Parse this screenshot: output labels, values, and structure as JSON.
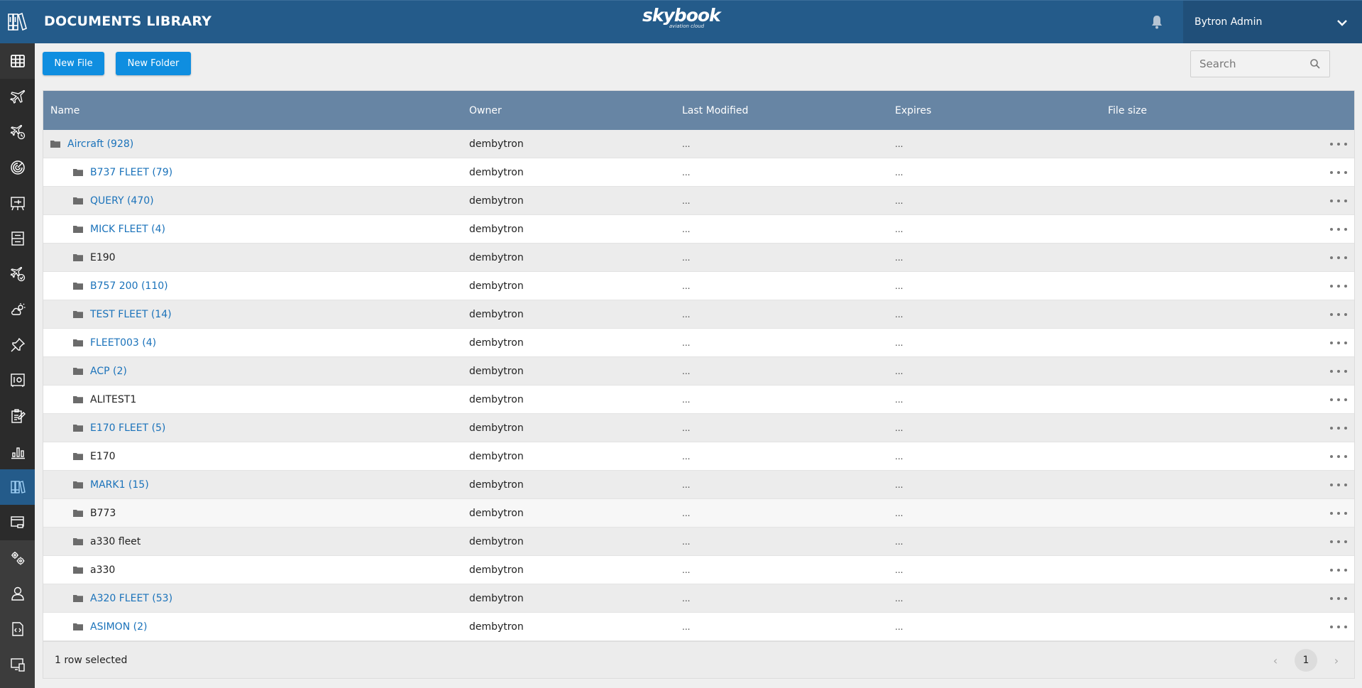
{
  "header": {
    "title": "DOCUMENTS LIBRARY",
    "brand_name": "skybook",
    "brand_tagline": "aviation cloud",
    "user_name": "Bytron Admin"
  },
  "colors": {
    "header_bg": "#245b8a",
    "accent_button": "#0f8ee0",
    "table_header_bg": "#6785a4",
    "link": "#1a72ba",
    "sidebar_bg": "#3c3c3c"
  },
  "sidebar": {
    "items": [
      {
        "icon": "grid-icon",
        "label": "Dashboard"
      },
      {
        "icon": "airplane-icon",
        "label": "Flights"
      },
      {
        "icon": "airplane-clock-icon",
        "label": "Flight schedule"
      },
      {
        "icon": "radar-icon",
        "label": "Tracking"
      },
      {
        "icon": "briefing-board-icon",
        "label": "Briefing"
      },
      {
        "icon": "cabinet-icon",
        "label": "Storage"
      },
      {
        "icon": "airplane-time-icon",
        "label": "Duty times"
      },
      {
        "icon": "weather-icon",
        "label": "Weather"
      },
      {
        "icon": "pin-icon",
        "label": "Pins"
      },
      {
        "icon": "safe-icon",
        "label": "Vault"
      },
      {
        "icon": "clipboard-edit-icon",
        "label": "Reports"
      },
      {
        "icon": "bar-chart-icon",
        "label": "Analytics"
      },
      {
        "icon": "library-icon",
        "label": "Documents Library",
        "active": true
      },
      {
        "icon": "window-icon",
        "label": "Display"
      },
      {
        "icon": "gears-icon",
        "label": "Settings"
      },
      {
        "icon": "user-icon",
        "label": "Users"
      },
      {
        "icon": "code-file-icon",
        "label": "API"
      },
      {
        "icon": "devices-icon",
        "label": "Devices"
      }
    ]
  },
  "toolbar": {
    "new_file_label": "New File",
    "new_folder_label": "New Folder",
    "search_placeholder": "Search"
  },
  "table": {
    "columns": [
      "Name",
      "Owner",
      "Last Modified",
      "Expires",
      "File size"
    ],
    "rows": [
      {
        "name": "Aircraft (928)",
        "link": true,
        "level": 0,
        "owner": "dembytron",
        "modified": "...",
        "expires": "...",
        "size": ""
      },
      {
        "name": "B737 FLEET (79)",
        "link": true,
        "level": 1,
        "owner": "dembytron",
        "modified": "...",
        "expires": "...",
        "size": ""
      },
      {
        "name": "QUERY (470)",
        "link": true,
        "level": 1,
        "owner": "dembytron",
        "modified": "...",
        "expires": "...",
        "size": ""
      },
      {
        "name": "MICK FLEET (4)",
        "link": true,
        "level": 1,
        "owner": "dembytron",
        "modified": "...",
        "expires": "...",
        "size": ""
      },
      {
        "name": "E190",
        "link": false,
        "level": 1,
        "owner": "dembytron",
        "modified": "...",
        "expires": "...",
        "size": ""
      },
      {
        "name": "B757 200 (110)",
        "link": true,
        "level": 1,
        "owner": "dembytron",
        "modified": "...",
        "expires": "...",
        "size": ""
      },
      {
        "name": "TEST FLEET (14)",
        "link": true,
        "level": 1,
        "owner": "dembytron",
        "modified": "...",
        "expires": "...",
        "size": ""
      },
      {
        "name": "FLEET003 (4)",
        "link": true,
        "level": 1,
        "owner": "dembytron",
        "modified": "...",
        "expires": "...",
        "size": ""
      },
      {
        "name": "ACP (2)",
        "link": true,
        "level": 1,
        "owner": "dembytron",
        "modified": "...",
        "expires": "...",
        "size": ""
      },
      {
        "name": "ALITEST1",
        "link": false,
        "level": 1,
        "owner": "dembytron",
        "modified": "...",
        "expires": "...",
        "size": ""
      },
      {
        "name": "E170 FLEET (5)",
        "link": true,
        "level": 1,
        "owner": "dembytron",
        "modified": "...",
        "expires": "...",
        "size": ""
      },
      {
        "name": "E170",
        "link": false,
        "level": 1,
        "owner": "dembytron",
        "modified": "...",
        "expires": "...",
        "size": ""
      },
      {
        "name": "MARK1 (15)",
        "link": true,
        "level": 1,
        "owner": "dembytron",
        "modified": "...",
        "expires": "...",
        "size": ""
      },
      {
        "name": "B773",
        "link": false,
        "level": 1,
        "owner": "dembytron",
        "modified": "...",
        "expires": "...",
        "size": "",
        "hover": true
      },
      {
        "name": "a330 fleet",
        "link": false,
        "level": 1,
        "owner": "dembytron",
        "modified": "...",
        "expires": "...",
        "size": ""
      },
      {
        "name": "a330",
        "link": false,
        "level": 1,
        "owner": "dembytron",
        "modified": "...",
        "expires": "...",
        "size": ""
      },
      {
        "name": "A320 FLEET (53)",
        "link": true,
        "level": 1,
        "owner": "dembytron",
        "modified": "...",
        "expires": "...",
        "size": ""
      },
      {
        "name": "ASIMON (2)",
        "link": true,
        "level": 1,
        "owner": "dembytron",
        "modified": "...",
        "expires": "...",
        "size": ""
      }
    ]
  },
  "footer": {
    "selection_text": "1 row selected",
    "current_page": "1",
    "prev_label": "‹",
    "next_label": "›"
  }
}
